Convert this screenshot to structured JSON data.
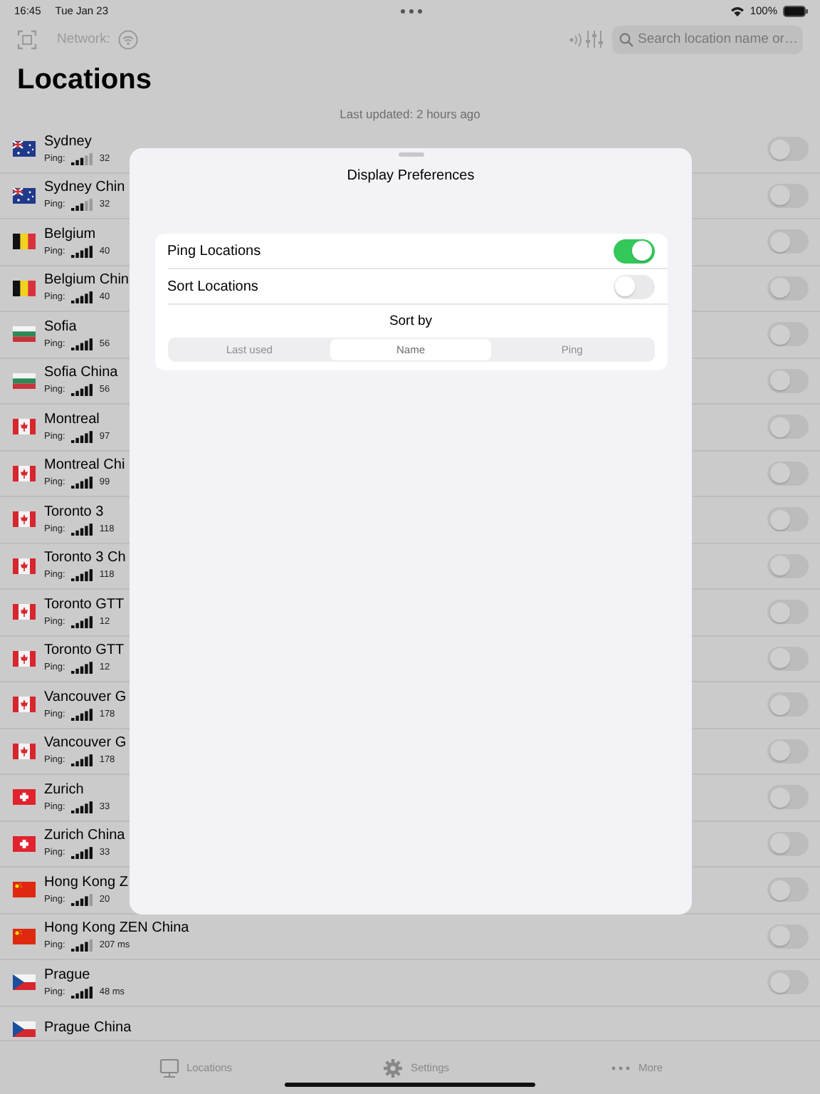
{
  "status_bar": {
    "time": "16:45",
    "date": "Tue Jan 23",
    "battery": "100%"
  },
  "toolbar": {
    "network_label": "Network:",
    "search": {
      "placeholder": "Search location name or…"
    }
  },
  "title": "Locations",
  "last_updated": "Last updated: 2 hours ago",
  "locations": [
    {
      "kind": "au",
      "name": "Sydney",
      "ping_label": "Ping:",
      "full": false,
      "weak": true,
      "ping": "32",
      "on": false
    },
    {
      "kind": "au",
      "name": "Sydney Chin",
      "ping_label": "Ping:",
      "full": false,
      "weak": true,
      "ping": "32",
      "on": false
    },
    {
      "kind": "be",
      "name": "Belgium",
      "ping_label": "Ping:",
      "full": true,
      "ping": "40",
      "on": false
    },
    {
      "kind": "be",
      "name": "Belgium Chin",
      "ping_label": "Ping:",
      "full": true,
      "ping": "40",
      "on": false
    },
    {
      "kind": "bg",
      "name": "Sofia",
      "ping_label": "Ping:",
      "full": true,
      "ping": "56",
      "on": false
    },
    {
      "kind": "bg",
      "name": "Sofia China",
      "ping_label": "Ping:",
      "full": true,
      "ping": "56",
      "on": false
    },
    {
      "kind": "ca",
      "name": "Montreal",
      "ping_label": "Ping:",
      "full": true,
      "ping": "97",
      "on": false
    },
    {
      "kind": "ca",
      "name": "Montreal Chi",
      "ping_label": "Ping:",
      "full": true,
      "ping": "99",
      "on": false
    },
    {
      "kind": "ca",
      "name": "Toronto 3",
      "ping_label": "Ping:",
      "full": true,
      "ping": "118",
      "on": false
    },
    {
      "kind": "ca",
      "name": "Toronto 3 Ch",
      "ping_label": "Ping:",
      "full": true,
      "ping": "118",
      "on": false
    },
    {
      "kind": "ca",
      "name": "Toronto GTT",
      "ping_label": "Ping:",
      "full": true,
      "ping": "12",
      "on": false
    },
    {
      "kind": "ca",
      "name": "Toronto GTT",
      "ping_label": "Ping:",
      "full": true,
      "ping": "12",
      "on": false
    },
    {
      "kind": "ca",
      "name": "Vancouver G",
      "ping_label": "Ping:",
      "full": true,
      "ping": "178",
      "on": false
    },
    {
      "kind": "ca",
      "name": "Vancouver G",
      "ping_label": "Ping:",
      "full": true,
      "ping": "178",
      "on": false
    },
    {
      "kind": "ch",
      "name": "Zurich",
      "ping_label": "Ping:",
      "full": true,
      "ping": "33",
      "on": false
    },
    {
      "kind": "ch",
      "name": "Zurich China",
      "ping_label": "Ping:",
      "full": true,
      "ping": "33",
      "on": false
    },
    {
      "kind": "cn",
      "name": "Hong Kong Z",
      "ping_label": "Ping:",
      "full": false,
      "weak": false,
      "ping": "20",
      "on": false
    },
    {
      "kind": "cn",
      "name": "Hong Kong ZEN China",
      "ping_label": "Ping:",
      "full": false,
      "weak": false,
      "ping": "207 ms",
      "on": false
    },
    {
      "kind": "cz",
      "name": "Prague",
      "ping_label": "Ping:",
      "full": true,
      "ping": "48 ms",
      "on": false
    },
    {
      "kind": "cz",
      "name": "Prague China"
    }
  ],
  "sheet": {
    "title": "Display Preferences",
    "settings": [
      {
        "label": "Ping Locations",
        "on": true
      },
      {
        "label": "Sort Locations",
        "on": false
      }
    ],
    "sort_by": {
      "label": "Sort by",
      "options": [
        {
          "label": "Last used",
          "selected": false
        },
        {
          "label": "Name",
          "selected": true
        },
        {
          "label": "Ping",
          "selected": false
        }
      ]
    }
  },
  "tab_bar": [
    {
      "label": "Locations"
    },
    {
      "label": "Settings"
    },
    {
      "label": "More"
    }
  ]
}
